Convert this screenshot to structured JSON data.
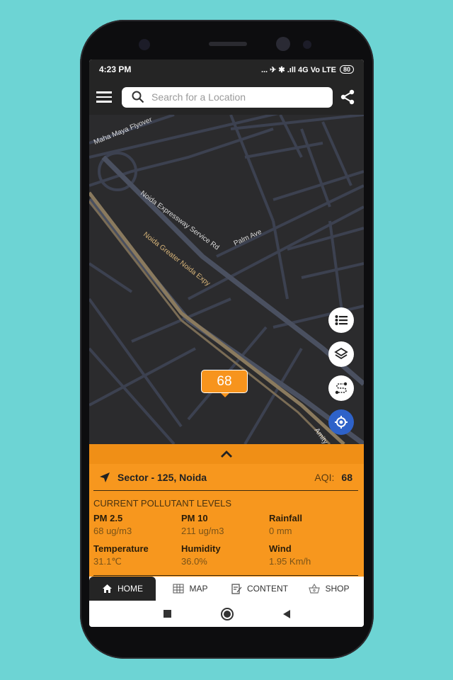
{
  "status_bar": {
    "time": "4:23 PM",
    "indicators": "... ✈ ✱ .ıll 4G Vo LTE",
    "battery": "80"
  },
  "header": {
    "search_placeholder": "Search for a Location",
    "icons": [
      "menu-icon",
      "search-icon",
      "share-icon"
    ]
  },
  "map": {
    "labels": [
      "Maha Maya Flyover",
      "Noida Expressway Service Rd",
      "Palm Ave",
      "Noida Greater Noida Expy",
      "Amity"
    ],
    "marker_value": "68",
    "marker_color": "#f7941d"
  },
  "panel": {
    "location": "Sector - 125, Noida",
    "aqi_label": "AQI:",
    "aqi_value": "68",
    "section_title": "CURRENT POLLUTANT LEVELS",
    "metrics": [
      {
        "label": "PM 2.5",
        "value": "68 ug/m3"
      },
      {
        "label": "PM 10",
        "value": "211 ug/m3"
      },
      {
        "label": "Rainfall",
        "value": "0 mm"
      },
      {
        "label": "Temperature",
        "value": "31.1℃"
      },
      {
        "label": "Humidity",
        "value": "36.0%"
      },
      {
        "label": "Wind",
        "value": "1.95 Km/h"
      }
    ],
    "color": "#f7971e"
  },
  "bottom_nav": [
    {
      "label": "HOME",
      "active": true
    },
    {
      "label": "MAP"
    },
    {
      "label": "CONTENT"
    },
    {
      "label": "SHOP"
    }
  ]
}
